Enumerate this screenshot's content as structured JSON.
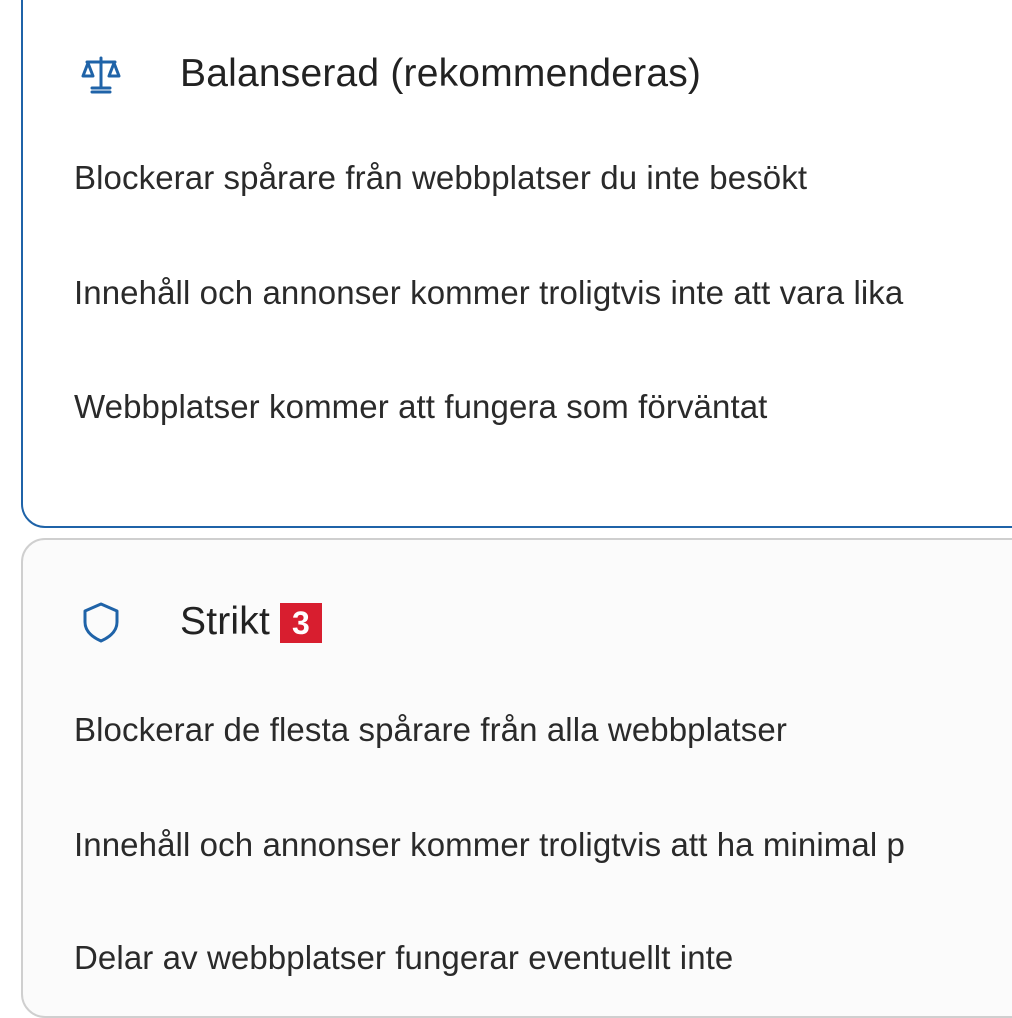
{
  "balanced": {
    "title": "Balanserad (rekommenderas)",
    "icon": "balance-scale-icon",
    "bullets": [
      "Blockerar spårare från webbplatser du inte besökt",
      "Innehåll och annonser kommer troligtvis inte att vara lika",
      "Webbplatser kommer att fungera som förväntat"
    ],
    "accent_color": "#1f63a8"
  },
  "strict": {
    "title": "Strikt",
    "badge": "3",
    "icon": "shield-icon",
    "bullets": [
      "Blockerar de flesta spårare från alla webbplatser",
      "Innehåll och annonser kommer troligtvis att ha minimal p",
      "Delar av webbplatser fungerar eventuellt inte"
    ],
    "badge_color": "#d81e2f"
  }
}
